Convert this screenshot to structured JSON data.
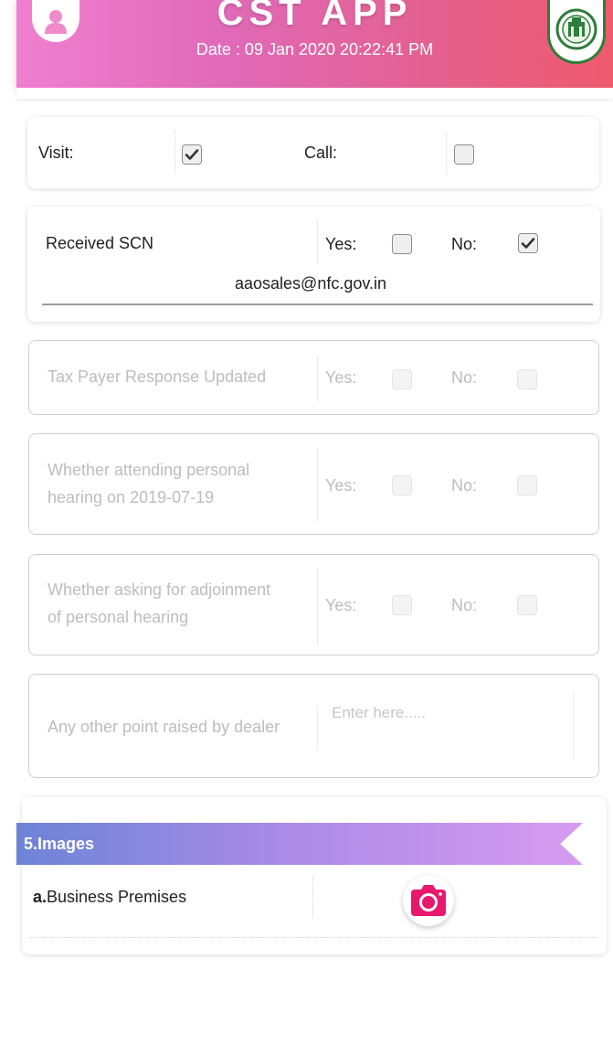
{
  "header": {
    "title": "CST APP",
    "date": "Date : 09 Jan 2020 20:22:41 PM"
  },
  "contact": {
    "visit_label": "Visit:",
    "visit_checked": true,
    "call_label": "Call:",
    "call_checked": false
  },
  "scn": {
    "label": "Received SCN",
    "yes_label": "Yes:",
    "yes_checked": false,
    "no_label": "No:",
    "no_checked": true,
    "email": "aaosales@nfc.gov.in"
  },
  "questions": [
    {
      "label": "Tax Payer Response Updated",
      "yes_label": "Yes:",
      "no_label": "No:"
    },
    {
      "label": "Whether attending personal hearing on 2019-07-19",
      "line1": "Whether attending personal",
      "line2": "hearing on 2019-07-19",
      "yes_label": "Yes:",
      "no_label": "No:"
    },
    {
      "label": "Whether asking for adjoinment of personal hearing",
      "line1": "Whether asking for adjoinment",
      "line2": "of personal hearing",
      "yes_label": "Yes:",
      "no_label": "No:"
    }
  ],
  "other_point": {
    "label": "Any other point raised by dealer",
    "placeholder": "Enter here....."
  },
  "images_section": {
    "title": "5.Images",
    "item_prefix": "a.",
    "item_label": "Business Premises"
  },
  "colors": {
    "header_gradient_start": "#f07fd0",
    "header_gradient_end": "#ee5a6e",
    "camera_accent": "#e8186f",
    "banner_start": "#6c84d6",
    "banner_end": "#d79bf0"
  },
  "icons": {
    "avatar": "user-icon",
    "emblem": "emblem-logo",
    "camera": "camera-icon",
    "check": "check-icon"
  }
}
